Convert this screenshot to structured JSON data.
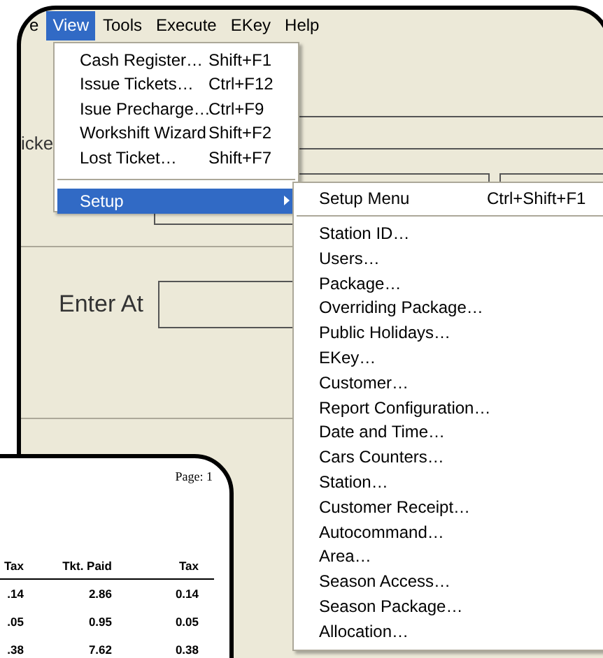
{
  "menu_bar": [
    {
      "label": "e",
      "selected": false
    },
    {
      "label": "View",
      "selected": true
    },
    {
      "label": "Tools",
      "selected": false
    },
    {
      "label": "Execute",
      "selected": false
    },
    {
      "label": "EKey",
      "selected": false
    },
    {
      "label": "Help",
      "selected": false
    }
  ],
  "form": {
    "ticket_label": "icke",
    "enter_at_label": "Enter At"
  },
  "view_menu": {
    "items": [
      {
        "label": "Cash Register…",
        "shortcut": "Shift+F1"
      },
      {
        "label": "Issue Tickets…",
        "shortcut": "Ctrl+F12"
      },
      {
        "label": "Isue Precharge…",
        "shortcut": "Ctrl+F9"
      },
      {
        "label": "Workshift Wizard",
        "shortcut": "Shift+F2"
      },
      {
        "label": "Lost Ticket…",
        "shortcut": "Shift+F7"
      }
    ],
    "submenu_item": {
      "label": "Setup",
      "selected": true
    }
  },
  "setup_menu": {
    "header": {
      "label": "Setup Menu",
      "shortcut": "Ctrl+Shift+F1"
    },
    "items": [
      "Station ID…",
      "Users…",
      "Package…",
      "Overriding Package…",
      "Public Holidays…",
      "EKey…",
      "Customer…",
      "Report Configuration…",
      "Date and Time…",
      "Cars Counters…",
      "Station…",
      "Customer Receipt…",
      "Autocommand…",
      "Area…",
      "Season Access…",
      "Season Package…",
      "Allocation…"
    ]
  },
  "report": {
    "page": "Page: 1",
    "columns": [
      "Tax",
      "Tkt. Paid",
      "Tax"
    ],
    "rows": [
      [
        ".14",
        "2.86",
        "0.14"
      ],
      [
        ".05",
        "0.95",
        "0.05"
      ],
      [
        ".38",
        "7.62",
        "0.38"
      ]
    ]
  }
}
